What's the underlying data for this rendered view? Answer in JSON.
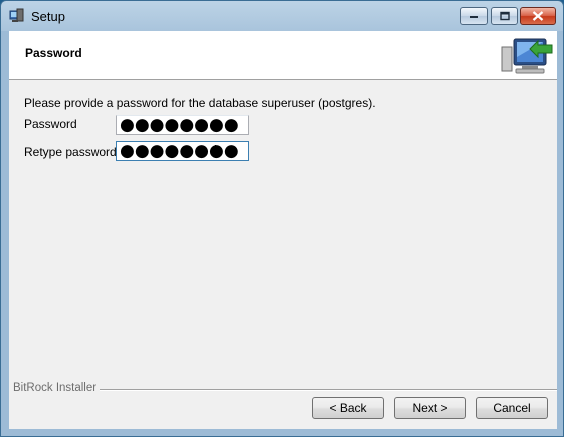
{
  "window": {
    "title": "Setup",
    "icon": "setup-app-icon",
    "controls": {
      "minimize": "minimize-icon",
      "maximize": "maximize-icon",
      "close": "close-icon"
    }
  },
  "header": {
    "title": "Password",
    "icon": "computer-with-arrow-icon"
  },
  "main": {
    "instructions": "Please provide a password for the database superuser (postgres).",
    "password_label": "Password",
    "password_value": "●●●●●●●●",
    "retype_label": "Retype password",
    "retype_value": "●●●●●●●●"
  },
  "footer": {
    "installer_label": "BitRock Installer",
    "back_label": "< Back",
    "next_label": "Next >",
    "cancel_label": "Cancel"
  }
}
